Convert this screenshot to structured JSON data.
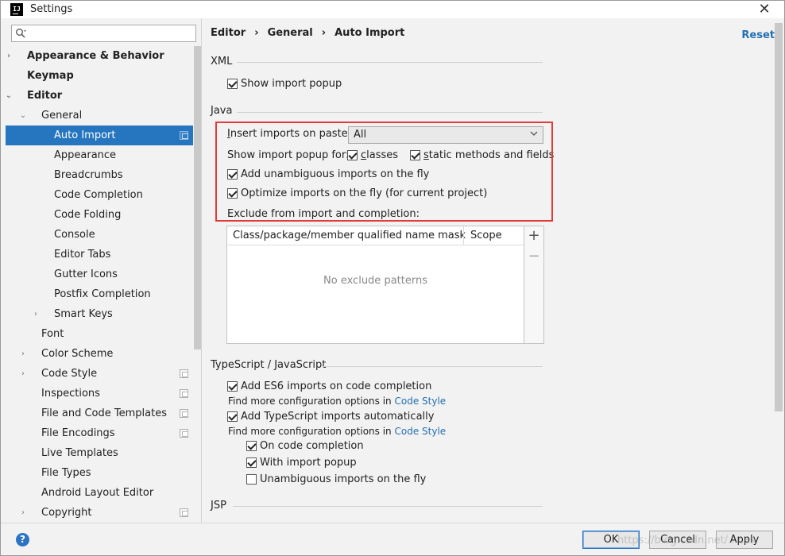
{
  "window": {
    "app_icon": "IJ",
    "title": "Settings",
    "close_glyph": "✕"
  },
  "sidebar": {
    "search_placeholder": "",
    "items": [
      {
        "label": "Appearance & Behavior",
        "level": 0,
        "bold": true,
        "arrow": "›"
      },
      {
        "label": "Keymap",
        "level": 0,
        "bold": true,
        "arrow": ""
      },
      {
        "label": "Editor",
        "level": 0,
        "bold": true,
        "arrow": "⌄"
      },
      {
        "label": "General",
        "level": 1,
        "bold": false,
        "arrow": "⌄"
      },
      {
        "label": "Auto Import",
        "level": 2,
        "bold": false,
        "arrow": "",
        "selected": true,
        "page_icon": true
      },
      {
        "label": "Appearance",
        "level": 2,
        "bold": false,
        "arrow": ""
      },
      {
        "label": "Breadcrumbs",
        "level": 2,
        "bold": false,
        "arrow": ""
      },
      {
        "label": "Code Completion",
        "level": 2,
        "bold": false,
        "arrow": ""
      },
      {
        "label": "Code Folding",
        "level": 2,
        "bold": false,
        "arrow": ""
      },
      {
        "label": "Console",
        "level": 2,
        "bold": false,
        "arrow": ""
      },
      {
        "label": "Editor Tabs",
        "level": 2,
        "bold": false,
        "arrow": ""
      },
      {
        "label": "Gutter Icons",
        "level": 2,
        "bold": false,
        "arrow": ""
      },
      {
        "label": "Postfix Completion",
        "level": 2,
        "bold": false,
        "arrow": ""
      },
      {
        "label": "Smart Keys",
        "level": 2,
        "bold": false,
        "arrow": "›"
      },
      {
        "label": "Font",
        "level": 1,
        "bold": false,
        "arrow": ""
      },
      {
        "label": "Color Scheme",
        "level": 1,
        "bold": false,
        "arrow": "›"
      },
      {
        "label": "Code Style",
        "level": 1,
        "bold": false,
        "arrow": "›",
        "page_icon": true
      },
      {
        "label": "Inspections",
        "level": 1,
        "bold": false,
        "arrow": "",
        "page_icon": true
      },
      {
        "label": "File and Code Templates",
        "level": 1,
        "bold": false,
        "arrow": "",
        "page_icon": true
      },
      {
        "label": "File Encodings",
        "level": 1,
        "bold": false,
        "arrow": "",
        "page_icon": true
      },
      {
        "label": "Live Templates",
        "level": 1,
        "bold": false,
        "arrow": ""
      },
      {
        "label": "File Types",
        "level": 1,
        "bold": false,
        "arrow": ""
      },
      {
        "label": "Android Layout Editor",
        "level": 1,
        "bold": false,
        "arrow": ""
      },
      {
        "label": "Copyright",
        "level": 1,
        "bold": false,
        "arrow": "›",
        "page_icon": true
      }
    ]
  },
  "breadcrumb": {
    "items": [
      "Editor",
      "General",
      "Auto Import"
    ],
    "separator": "›"
  },
  "reset_label": "Reset",
  "xml": {
    "title": "XML",
    "show_import_popup": {
      "label": "Show import popup",
      "checked": true
    }
  },
  "java": {
    "title": "Java",
    "insert_label_u": "I",
    "insert_label_rest": "nsert imports on paste:",
    "insert_value": "All",
    "show_popup_for_label": "Show import popup for:",
    "classes": {
      "label_u": "c",
      "label_rest": "lasses",
      "checked": true
    },
    "static_methods": {
      "label_u": "s",
      "label_rest": "tatic methods and fields",
      "checked": true
    },
    "add_unambiguous": {
      "label": "Add unambiguous imports on the fly",
      "checked": true
    },
    "optimize": {
      "label": "Optimize imports on the fly (for current project)",
      "checked": true
    },
    "exclude_label": "Exclude from import and completion:",
    "table": {
      "col1": "Class/package/member qualified name mask",
      "col2": "Scope",
      "empty_text": "No exclude patterns",
      "add_glyph": "+",
      "remove_glyph": "−"
    }
  },
  "typescript": {
    "title": "TypeScript / JavaScript",
    "es6": {
      "label": "Add ES6 imports on code completion",
      "checked": true
    },
    "find_more_1": "Find more configuration options in",
    "code_style_link_1": "Code Style",
    "ts_auto": {
      "label": "Add TypeScript imports automatically",
      "checked": true
    },
    "find_more_2": "Find more configuration options in",
    "code_style_link_2": "Code Style",
    "on_completion": {
      "label": "On code completion",
      "checked": true
    },
    "with_popup": {
      "label": "With import popup",
      "checked": true
    },
    "unambiguous": {
      "label": "Unambiguous imports on the fly",
      "checked": false
    }
  },
  "jsp": {
    "title": "JSP"
  },
  "buttons": {
    "help": "?",
    "ok": "OK",
    "cancel": "Cancel",
    "apply": "Apply"
  },
  "watermark": "https://blog.csdn.net/...cas"
}
